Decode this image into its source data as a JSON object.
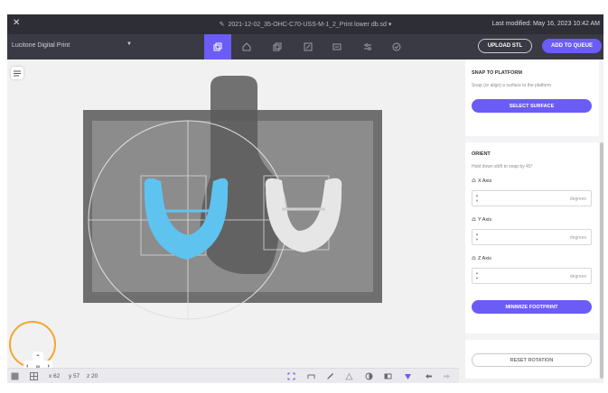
{
  "titlebar": {
    "close_icon": "close-icon",
    "file_name": "2021-12-02_35-OHC-C70-USS-M-1_2_Print lower db.sd",
    "last_saved": "Last modified: May 16, 2023 10:42 AM"
  },
  "toolbar": {
    "printer": "Lucitone Digital Print",
    "tools": [
      "layout-icon",
      "home-icon",
      "copy-icon",
      "orient-icon",
      "layers-icon",
      "settings-sliders-icon",
      "check-icon"
    ],
    "active_tool": "layout-icon",
    "upload_label": "UPLOAD STL",
    "queue_label": "ADD TO QUEUE"
  },
  "snap": {
    "title": "SNAP TO PLATFORM",
    "description": "Snap (or align) a surface to the platform",
    "button": "SELECT SURFACE"
  },
  "orient": {
    "title": "ORIENT",
    "hint": "Hold down shift to snap by 45°",
    "x_label": "X Axis",
    "y_label": "Y Axis",
    "z_label": "Z Axis",
    "x_value": "",
    "y_value": "",
    "z_value": "",
    "unit": "degrees",
    "minimize_label": "MINIMIZE FOOTPRINT"
  },
  "reset": {
    "label": "RESET ROTATION"
  },
  "status": {
    "x": "x 62",
    "y": "y 57",
    "z": "z 20"
  },
  "colors": {
    "accent": "#6b5cf6",
    "titlebar": "#2e2e36",
    "toolbar": "#3a3a44",
    "selected_model": "#5fc3f0",
    "highlight_circle": "#f2a630"
  }
}
